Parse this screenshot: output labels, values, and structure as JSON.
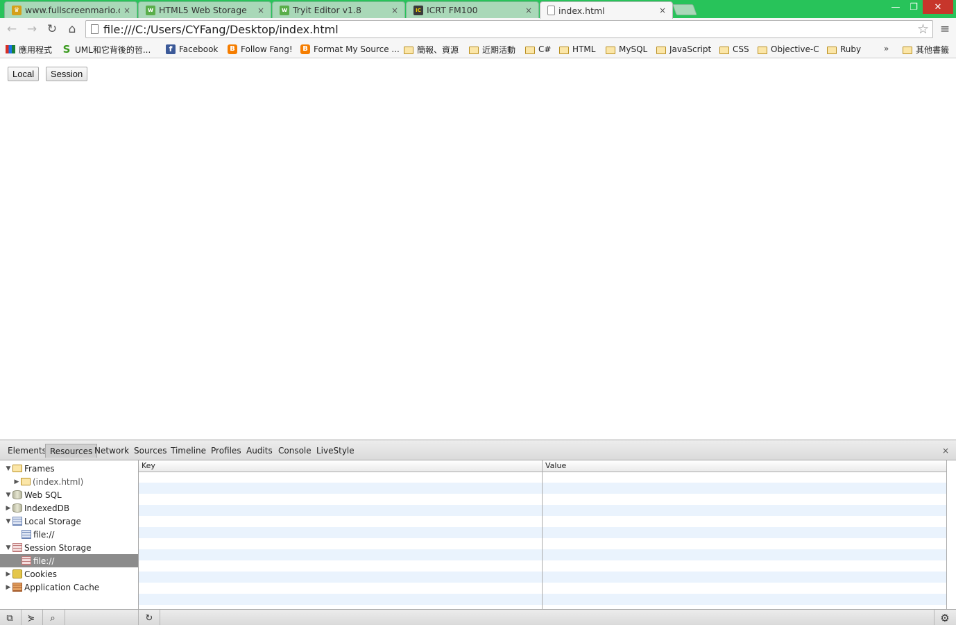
{
  "tabs": [
    {
      "title": "www.fullscreenmario.com",
      "favicon": "mario-icon",
      "active": false
    },
    {
      "title": "HTML5 Web Storage",
      "favicon": "w3-icon",
      "active": false
    },
    {
      "title": "Tryit Editor v1.8",
      "favicon": "w3-icon",
      "active": false
    },
    {
      "title": "ICRT FM100",
      "favicon": "icrt-icon",
      "active": false
    },
    {
      "title": "index.html",
      "favicon": "page-icon",
      "active": true
    }
  ],
  "tab_close_glyph": "×",
  "window": {
    "minimize": "—",
    "restore": "❐",
    "close": "✕"
  },
  "address": {
    "url": "file:///C:/Users/CYFang/Desktop/index.html"
  },
  "nav": {
    "back": "←",
    "forward": "→",
    "reload": "↻",
    "home": "⌂",
    "star": "☆",
    "menu": "≡"
  },
  "bookmarks": [
    {
      "label": "應用程式",
      "icon": "apps-icon"
    },
    {
      "label": "UML和它背後的哲...",
      "icon": "site-s-icon"
    },
    {
      "label": "Facebook",
      "icon": "facebook-icon"
    },
    {
      "label": "Follow Fang!",
      "icon": "blogger-icon"
    },
    {
      "label": "Format My Source ...",
      "icon": "blogger-icon"
    },
    {
      "label": "簡報、資源",
      "icon": "folder-icon"
    },
    {
      "label": "近期活動",
      "icon": "folder-icon"
    },
    {
      "label": "C#",
      "icon": "folder-icon"
    },
    {
      "label": "HTML",
      "icon": "folder-icon"
    },
    {
      "label": "MySQL",
      "icon": "folder-icon"
    },
    {
      "label": "JavaScript",
      "icon": "folder-icon"
    },
    {
      "label": "CSS",
      "icon": "folder-icon"
    },
    {
      "label": "Objective-C",
      "icon": "folder-icon"
    },
    {
      "label": "Ruby",
      "icon": "folder-icon"
    }
  ],
  "bookmarks_more": "»",
  "bookmarks_other": "其他書籤",
  "page": {
    "buttons": [
      "Local",
      "Session"
    ]
  },
  "devtools": {
    "tabs": [
      "Elements",
      "Resources",
      "Network",
      "Sources",
      "Timeline",
      "Profiles",
      "Audits",
      "Console",
      "LiveStyle"
    ],
    "selected_tab": "Resources",
    "close": "×",
    "tree": [
      {
        "label": "Frames",
        "arrow": "▼",
        "icon": "folder-icon",
        "indent": 0
      },
      {
        "label": "(index.html)",
        "arrow": "▶",
        "icon": "folder-icon",
        "indent": 1
      },
      {
        "label": "Web SQL",
        "arrow": "▼",
        "icon": "database-icon",
        "indent": 0
      },
      {
        "label": "IndexedDB",
        "arrow": "▶",
        "icon": "database-icon",
        "indent": 0
      },
      {
        "label": "Local Storage",
        "arrow": "▼",
        "icon": "local-storage-icon",
        "indent": 0
      },
      {
        "label": "file://",
        "arrow": "",
        "icon": "local-storage-icon",
        "indent": 1
      },
      {
        "label": "Session Storage",
        "arrow": "▼",
        "icon": "session-storage-icon",
        "indent": 0
      },
      {
        "label": "file://",
        "arrow": "",
        "icon": "session-storage-icon",
        "indent": 1,
        "selected": true
      },
      {
        "label": "Cookies",
        "arrow": "▶",
        "icon": "cookie-icon",
        "indent": 0
      },
      {
        "label": "Application Cache",
        "arrow": "▶",
        "icon": "app-cache-icon",
        "indent": 0
      }
    ],
    "grid": {
      "columns": [
        "Key",
        "Value"
      ],
      "rows": []
    },
    "status": {
      "dock": "⧉",
      "console": "⋟",
      "search": "⌕",
      "refresh": "↻",
      "settings": "⚙"
    }
  },
  "colors": {
    "chrome_frame": "#28c35a",
    "inactive_tab": "#a9d8b8",
    "selected_tree_row": "#8c8c8c",
    "grid_stripe": "#eaf3fd"
  }
}
